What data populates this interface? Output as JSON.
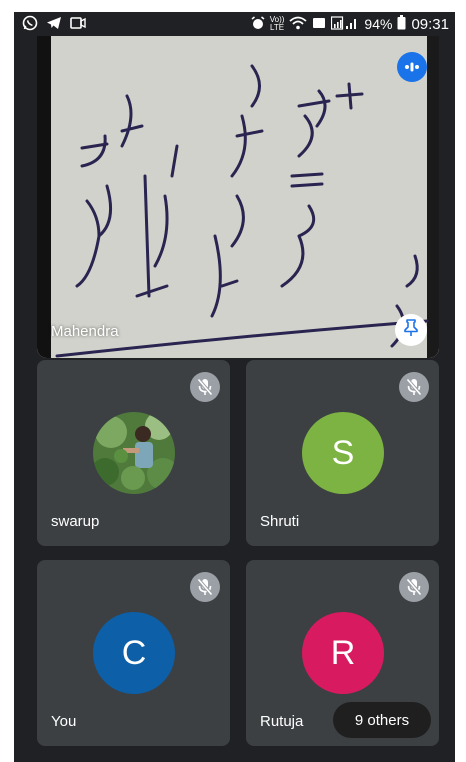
{
  "status_bar": {
    "left_icons": [
      "whatsapp-icon",
      "telegram-icon",
      "screen-record-icon"
    ],
    "right_icons": [
      "alarm-icon",
      "volte-icon",
      "wifi-icon",
      "screen-cast-icon",
      "signal-icon",
      "battery-icon"
    ],
    "volte_top": "Vo))",
    "volte_bottom": "LTE",
    "battery": "94%",
    "time": "09:31"
  },
  "main_video": {
    "participant_name": "Mahendra",
    "speaking_indicator_color": "#1a73e8",
    "pin_icon_color": "#1a73e8"
  },
  "participants": [
    {
      "name": "swarup",
      "avatar_type": "photo",
      "muted": true
    },
    {
      "name": "Shruti",
      "avatar_initial": "S",
      "avatar_color": "#7cb342",
      "muted": true
    },
    {
      "name": "You",
      "avatar_initial": "C",
      "avatar_color": "#0d5fa8",
      "muted": true
    },
    {
      "name": "Rutuja",
      "avatar_initial": "R",
      "avatar_color": "#d81b60",
      "muted": true
    }
  ],
  "others_label": "9 others"
}
